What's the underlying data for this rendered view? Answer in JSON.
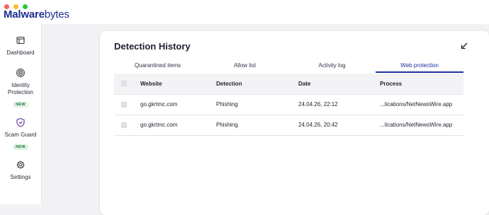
{
  "app": {
    "logo_bold": "Malware",
    "logo_light": "bytes"
  },
  "sidebar": {
    "items": [
      {
        "label": "Dashboard",
        "icon": "dashboard-icon"
      },
      {
        "label": "Identity Protection",
        "icon": "fingerprint-icon",
        "badge": "NEW"
      },
      {
        "label": "Scam Guard",
        "icon": "scam-guard-shield-icon",
        "badge": "NEW"
      },
      {
        "label": "Settings",
        "icon": "gear-icon"
      }
    ]
  },
  "main": {
    "title": "Detection History",
    "tabs": [
      {
        "label": "Quarantined items",
        "active": false
      },
      {
        "label": "Allow list",
        "active": false
      },
      {
        "label": "Activity log",
        "active": false
      },
      {
        "label": "Web protection",
        "active": true
      }
    ],
    "table": {
      "columns": [
        "Website",
        "Detection",
        "Date",
        "Process"
      ],
      "rows": [
        {
          "website": "go.gkrtmc.com",
          "detection": "Phishing",
          "date": "24.04.26, 22:12",
          "process": "...lications/NetNewsWire.app"
        },
        {
          "website": "go.gkrtmc.com",
          "detection": "Phishing",
          "date": "24.04.26, 20:42",
          "process": "...lications/NetNewsWire.app"
        }
      ]
    }
  },
  "colors": {
    "accent": "#1b2fa3",
    "brand": "#1b2f8f",
    "badge_bg": "#dff3e4",
    "badge_text": "#1e7a3a"
  }
}
